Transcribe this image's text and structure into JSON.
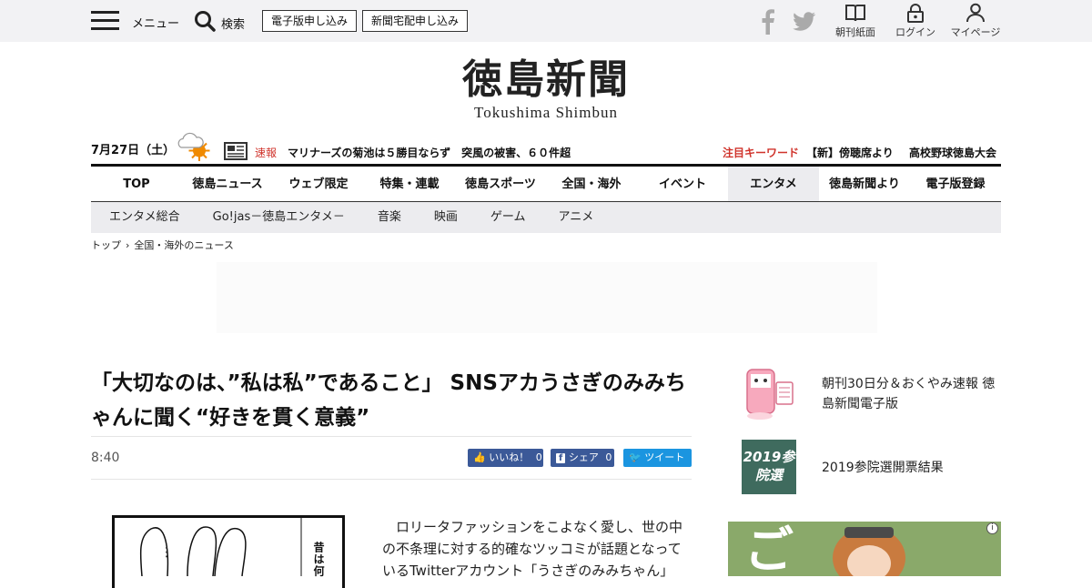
{
  "header": {
    "menu_label": "メニュー",
    "search_label": "検索",
    "btn_digital": "電子版申し込み",
    "btn_delivery": "新聞宅配申し込み",
    "util_paper": "朝刊紙面",
    "util_login": "ログイン",
    "util_mypage": "マイページ"
  },
  "logo": {
    "kanji": "徳島新聞",
    "roman": "Tokushima Shimbun"
  },
  "infobar": {
    "date": "7月27日（土）",
    "breaking_label": "速報",
    "breaking_headline": "マリナーズの菊池は５勝目ならず　突風の被害、６０件超",
    "keyword_label": "注目キーワード",
    "keyword1": "【新】傍聴席より",
    "keyword2": "高校野球徳島大会"
  },
  "nav": {
    "items": [
      "TOP",
      "徳島ニュース",
      "ウェブ限定",
      "特集・連載",
      "徳島スポーツ",
      "全国・海外",
      "イベント",
      "エンタメ",
      "徳島新聞より",
      "電子版登録"
    ],
    "active_index": 7
  },
  "subnav": {
    "items": [
      "エンタメ総合",
      "Go!jas－徳島エンタメ－",
      "音楽",
      "映画",
      "ゲーム",
      "アニメ"
    ]
  },
  "breadcrumb": {
    "home": "トップ",
    "current": "全国・海外のニュース"
  },
  "article": {
    "title": "「大切なのは、”私は私”であること」 SNSアカうさぎのみみちゃんに聞く“好きを貫く意義”",
    "time": "8:40",
    "like_label": "いいね！",
    "like_count": "0",
    "share_label": "シェア",
    "share_count": "0",
    "tweet_label": "ツイート",
    "body": "　ロリータファッションをこよなく愛し、世の中の不条理に対する的確なツッコミが話題となっているTwitterアカウント「うさぎのみみちゃん」",
    "manga_text": "昔は何"
  },
  "sidebar": {
    "item1": "朝刊30日分＆おくやみ速報 徳島新聞電子版",
    "item2": "2019参院選開票結果",
    "thumb2_text": "2019参院選",
    "ad_chars": "ご　あ"
  },
  "colors": {
    "accent_red": "#d0342c",
    "facebook": "#3b5998",
    "twitter": "#1b95e0"
  }
}
